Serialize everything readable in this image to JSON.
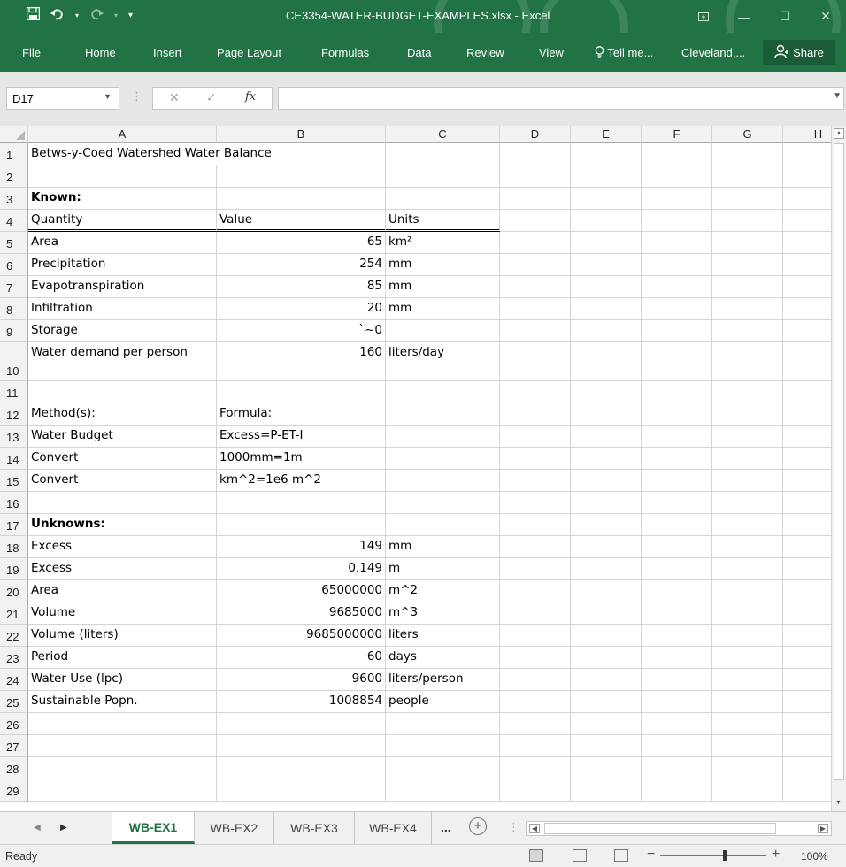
{
  "window": {
    "title": "CE3354-WATER-BUDGET-EXAMPLES.xlsx - Excel"
  },
  "ribbon": {
    "tabs": [
      "File",
      "Home",
      "Insert",
      "Page Layout",
      "Formulas",
      "Data",
      "Review",
      "View"
    ],
    "tell_me": "Tell me...",
    "user": "Cleveland,...",
    "share": "Share"
  },
  "formula_bar": {
    "name_box": "D17",
    "fx": "fx",
    "formula": ""
  },
  "columns": [
    "A",
    "B",
    "C",
    "D",
    "E",
    "F",
    "G",
    "H"
  ],
  "rows": [
    {
      "num": "1",
      "a": "Betws-y-Coed Watershed Water Balance",
      "b": "",
      "c": ""
    },
    {
      "num": "2",
      "a": "",
      "b": "",
      "c": ""
    },
    {
      "num": "3",
      "a": "Known:",
      "b": "",
      "c": ""
    },
    {
      "num": "4",
      "a": "Quantity",
      "b": "Value",
      "c": "Units"
    },
    {
      "num": "5",
      "a": "Area",
      "b": "65",
      "c": "km²"
    },
    {
      "num": "6",
      "a": "Precipitation",
      "b": "254",
      "c": "mm"
    },
    {
      "num": "7",
      "a": "Evapotranspiration",
      "b": "85",
      "c": "mm"
    },
    {
      "num": "8",
      "a": "Infiltration",
      "b": "20",
      "c": "mm"
    },
    {
      "num": "9",
      "a": "Storage",
      "b": "`~0",
      "c": ""
    },
    {
      "num": "10",
      "a": "Water demand per person",
      "b": "160",
      "c": "liters/day"
    },
    {
      "num": "11",
      "a": "",
      "b": "",
      "c": ""
    },
    {
      "num": "12",
      "a": "Method(s):",
      "b": "Formula:",
      "c": ""
    },
    {
      "num": "13",
      "a": "Water Budget",
      "b": "Excess=P-ET-I",
      "c": ""
    },
    {
      "num": "14",
      "a": "Convert",
      "b": "1000mm=1m",
      "c": ""
    },
    {
      "num": "15",
      "a": "Convert",
      "b": "km^2=1e6 m^2",
      "c": ""
    },
    {
      "num": "16",
      "a": "",
      "b": "",
      "c": ""
    },
    {
      "num": "17",
      "a": "Unknowns:",
      "b": "",
      "c": ""
    },
    {
      "num": "18",
      "a": "Excess",
      "b": "149",
      "c": "mm"
    },
    {
      "num": "19",
      "a": "Excess",
      "b": "0.149",
      "c": "m"
    },
    {
      "num": "20",
      "a": "Area",
      "b": "65000000",
      "c": "m^2"
    },
    {
      "num": "21",
      "a": "Volume",
      "b": "9685000",
      "c": "m^3"
    },
    {
      "num": "22",
      "a": "Volume (liters)",
      "b": "9685000000",
      "c": "liters"
    },
    {
      "num": "23",
      "a": "Period",
      "b": "60",
      "c": "days"
    },
    {
      "num": "24",
      "a": "Water Use (lpc)",
      "b": "9600",
      "c": "liters/person"
    },
    {
      "num": "25",
      "a": "Sustainable Popn.",
      "b": "1008854",
      "c": "people"
    },
    {
      "num": "26",
      "a": "",
      "b": "",
      "c": ""
    },
    {
      "num": "27",
      "a": "",
      "b": "",
      "c": ""
    },
    {
      "num": "28",
      "a": "",
      "b": "",
      "c": ""
    },
    {
      "num": "29",
      "a": "",
      "b": "",
      "c": ""
    }
  ],
  "sheet_tabs": [
    "WB-EX1",
    "WB-EX2",
    "WB-EX3",
    "WB-EX4"
  ],
  "sheet_tabs_more": "...",
  "status": {
    "ready": "Ready",
    "zoom": "100%"
  },
  "colors": {
    "excel_green": "#217346",
    "grid_line": "#d4d4d4",
    "header_bg": "#f2f2f2"
  }
}
